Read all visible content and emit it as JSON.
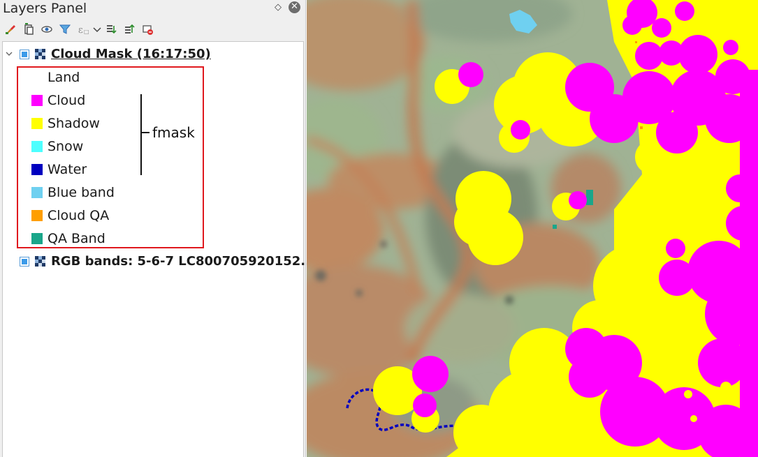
{
  "panel": {
    "title": "Layers Panel",
    "float_icon": "◇",
    "close_icon": "✕"
  },
  "toolbar": {
    "buttons": [
      {
        "name": "style-paintbrush-icon"
      },
      {
        "name": "add-group-icon"
      },
      {
        "name": "eye-visibility-icon"
      },
      {
        "name": "filter-legend-icon"
      },
      {
        "name": "filter-expression-icon"
      },
      {
        "name": "dropdown-chevron-icon"
      },
      {
        "name": "expand-all-icon"
      },
      {
        "name": "collapse-all-icon"
      },
      {
        "name": "remove-layer-icon"
      }
    ]
  },
  "layers": [
    {
      "name": "Cloud Mask (16:17:50)",
      "checked": true,
      "legend": [
        {
          "label": "Land",
          "color": "#ffffff"
        },
        {
          "label": "Cloud",
          "color": "#ff00ff"
        },
        {
          "label": "Shadow",
          "color": "#ffff00"
        },
        {
          "label": "Snow",
          "color": "#4dffff"
        },
        {
          "label": "Water",
          "color": "#0000c0"
        },
        {
          "label": "Blue band",
          "color": "#6fd0f0"
        },
        {
          "label": "Cloud QA",
          "color": "#ff9e00"
        },
        {
          "label": "QA Band",
          "color": "#1aa68a"
        }
      ]
    },
    {
      "name": "RGB bands: 5-6-7 LC800705920152...",
      "checked": true
    }
  ],
  "annotation": {
    "label": "fmask",
    "highlight_color": "#e0191e"
  },
  "map": {
    "colors": {
      "cloud": "#ff00ff",
      "shadow": "#ffff00",
      "water": "#0000c0",
      "snow": "#6fd0f0",
      "land_green": "#9db190",
      "land_brown": "#b78a66"
    }
  }
}
